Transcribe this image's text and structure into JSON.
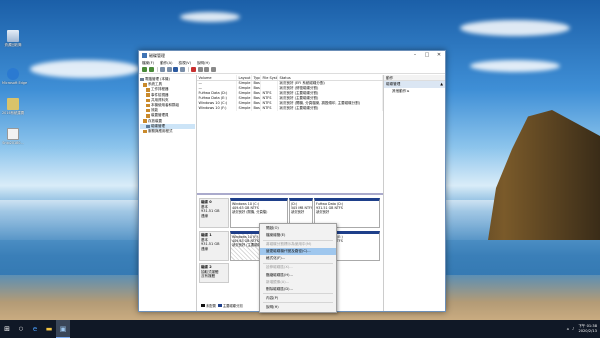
{
  "desktop": {
    "icons": [
      {
        "label": "資源回收筒",
        "name": "recycle-bin"
      },
      {
        "label": "Microsoft Edge",
        "name": "edge"
      },
      {
        "label": "2016系統建置",
        "name": "folder"
      },
      {
        "label": "Snip20180...",
        "name": "file"
      }
    ]
  },
  "window": {
    "title": "磁碟管理",
    "menu": [
      "檔案(F)",
      "動作(A)",
      "檢視(V)",
      "說明(H)"
    ],
    "tree": [
      "電腦管理 (本機)",
      "系統工具",
      "工作排程器",
      "事件檢視器",
      "共用資料夾",
      "本機使用者和群組",
      "效能",
      "裝置管理員",
      "存放裝置",
      "磁碟管理",
      "服務與應用程式"
    ],
    "volume_headers": [
      "Volume",
      "Layout",
      "Type",
      "File System",
      "Status"
    ],
    "volumes": [
      [
        "—",
        "Simple",
        "Basic",
        "",
        "狀況良好 (EFI 系統磁碟分割)"
      ],
      [
        "—",
        "Simple",
        "Basic",
        "",
        "狀況良好 (修復磁碟分割)"
      ],
      [
        "FuHwa Data (D:)",
        "Simple",
        "Basic",
        "NTFS",
        "狀況良好 (主要磁碟分割)"
      ],
      [
        "FuHwa Data (E:)",
        "Simple",
        "Basic",
        "NTFS",
        "狀況良好 (主要磁碟分割)"
      ],
      [
        "Windows 10 (C:)",
        "Simple",
        "Basic",
        "NTFS",
        "狀況良好 (開機, 分頁檔案, 損毀傾印, 主要磁碟分割)"
      ],
      [
        "Windows 10 (F:)",
        "Simple",
        "Basic",
        "NTFS",
        "狀況良好 (主要磁碟分割)"
      ]
    ],
    "disks": [
      {
        "label": "磁碟 0",
        "info": [
          "基本",
          "931.51 GB",
          "連線"
        ],
        "parts": [
          {
            "title": "Windows 10 (C:)",
            "size": "409.63 GB NTFS",
            "status": "狀況良好 (開機, 分頁檔)"
          },
          {
            "title": "(D:)",
            "size": "505 MB NTFS",
            "status": "狀況良好"
          },
          {
            "title": "FuHwa Data (D:)",
            "size": "931.51 GB NTFS",
            "status": "狀況良好"
          }
        ]
      },
      {
        "label": "磁碟 1",
        "info": [
          "基本",
          "931.51 GB",
          "連線"
        ],
        "parts": [
          {
            "title": "Windows 10 (F:)",
            "size": "409.63 GB NTFS",
            "status": "狀況良好 (主要磁碟分割)"
          },
          {
            "title": "",
            "size": "506 MB",
            "status": "狀況良好"
          },
          {
            "title": "FuHwa Data (E:)",
            "size": "931.51 GB NTFS",
            "status": "狀況良好"
          }
        ]
      },
      {
        "label": "磁碟 2",
        "info": [
          "抽取式媒體",
          "沒有媒體"
        ],
        "parts": []
      }
    ],
    "legend": [
      "未配置",
      "主要磁碟分割"
    ],
    "actions": {
      "header": "動作",
      "section": "磁碟管理",
      "more": "其他動作"
    }
  },
  "context_menu": {
    "items": [
      {
        "label": "開啟(O)",
        "disabled": false
      },
      {
        "label": "檔案總管(E)",
        "disabled": false
      },
      {
        "sep": true
      },
      {
        "label": "將磁碟分割標示為使用中(M)",
        "disabled": true
      },
      {
        "label": "變更磁碟機代號及路徑(C)...",
        "disabled": false,
        "highlight": true
      },
      {
        "label": "格式化(F)...",
        "disabled": false
      },
      {
        "sep": true
      },
      {
        "label": "延伸磁碟區(X)...",
        "disabled": true
      },
      {
        "label": "壓縮磁碟區(H)...",
        "disabled": false
      },
      {
        "label": "新增鏡像(A)...",
        "disabled": true
      },
      {
        "label": "刪除磁碟區(D)...",
        "disabled": false
      },
      {
        "sep": true
      },
      {
        "label": "內容(P)",
        "disabled": false
      },
      {
        "sep": true
      },
      {
        "label": "說明(H)",
        "disabled": false
      }
    ]
  },
  "taskbar": {
    "time": "下午 01:38",
    "date": "2020/2/13"
  },
  "colors": {
    "partition_header": "#1e3f8a",
    "selection": "#9fc7ee"
  }
}
